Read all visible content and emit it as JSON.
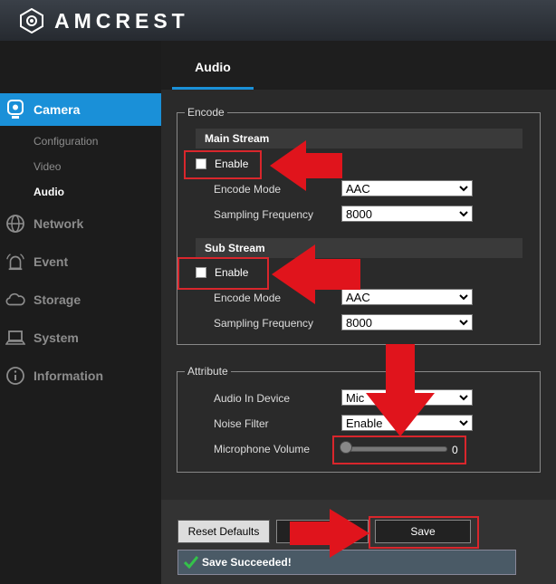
{
  "brand": {
    "logo_text": "AMCREST"
  },
  "sidebar": {
    "items": [
      {
        "label": "Camera",
        "icon": "camera-icon",
        "active": true
      },
      {
        "label": "Network",
        "icon": "globe-icon"
      },
      {
        "label": "Event",
        "icon": "alarm-icon"
      },
      {
        "label": "Storage",
        "icon": "cloud-icon"
      },
      {
        "label": "System",
        "icon": "laptop-icon"
      },
      {
        "label": "Information",
        "icon": "info-icon"
      }
    ],
    "subitems": [
      "Configuration",
      "Video",
      "Audio"
    ]
  },
  "tab": {
    "label": "Audio"
  },
  "encode": {
    "legend": "Encode",
    "main_stream": {
      "title": "Main Stream",
      "enable_label": "Enable",
      "encode_mode_label": "Encode Mode",
      "encode_mode_value": "AAC",
      "sampling_label": "Sampling Frequency",
      "sampling_value": "8000"
    },
    "sub_stream": {
      "title": "Sub Stream",
      "enable_label": "Enable",
      "encode_mode_label": "Encode Mode",
      "encode_mode_value": "AAC",
      "sampling_label": "Sampling Frequency",
      "sampling_value": "8000"
    }
  },
  "attribute": {
    "legend": "Attribute",
    "audio_in_label": "Audio In Device",
    "audio_in_value": "Mic",
    "noise_filter_label": "Noise Filter",
    "noise_filter_value": "Enable",
    "mic_volume_label": "Microphone Volume",
    "mic_volume_value": "0"
  },
  "footer": {
    "reset_label": "Reset Defaults",
    "save_label": "Save",
    "status_text": "Save Succeeded!"
  },
  "colors": {
    "accent": "#1a90d8",
    "highlight": "#d9262c",
    "arrow": "#e0141c"
  }
}
